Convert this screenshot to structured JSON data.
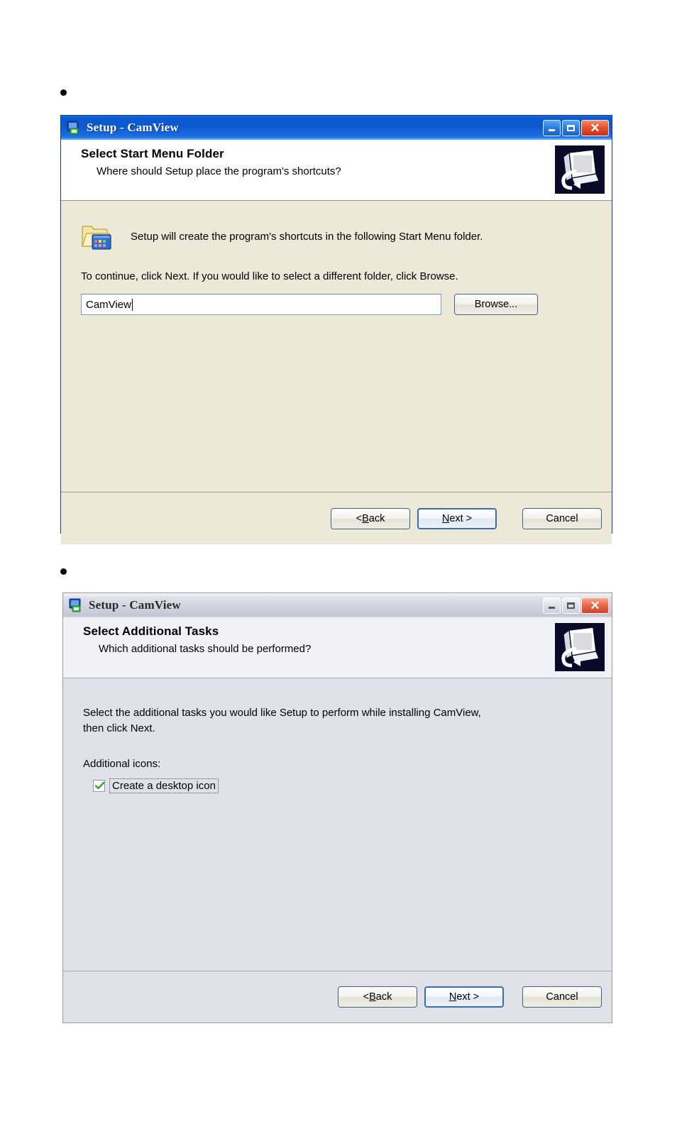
{
  "document": {
    "bullets": [
      "•",
      "•"
    ]
  },
  "dialog1": {
    "window_title": "Setup - CamView",
    "titlebar_icon": "setup-app-icon",
    "state": "active",
    "buttons": {
      "minimize": "minimize-icon",
      "maximize": "maximize-icon",
      "close": "close-icon",
      "close_glyph": "✕"
    },
    "header": {
      "title": "Select Start Menu Folder",
      "subtitle": "Where should Setup place the program's shortcuts?",
      "graphic": "computer-monitor-icon"
    },
    "body": {
      "folder_icon": "start-menu-folder-icon",
      "folder_text": "Setup will create the program's shortcuts in the following Start Menu folder.",
      "instruction": "To continue, click Next. If you would like to select a different folder, click Browse.",
      "input_value": "CamView",
      "input_placeholder": "",
      "browse_label_pre": "B",
      "browse_label_underline": "r",
      "browse_label_post": "owse..."
    },
    "footer": {
      "back_pre": "< ",
      "back_underline": "B",
      "back_post": "ack",
      "next_underline": "N",
      "next_post": "ext >",
      "cancel": "Cancel"
    }
  },
  "dialog2": {
    "window_title": "Setup - CamView",
    "titlebar_icon": "setup-app-icon",
    "state": "inactive",
    "buttons": {
      "minimize": "minimize-icon",
      "maximize": "maximize-icon",
      "close": "close-icon",
      "close_glyph": "✕"
    },
    "header": {
      "title": "Select Additional Tasks",
      "subtitle": "Which additional tasks should be performed?",
      "graphic": "computer-monitor-icon"
    },
    "body": {
      "instruction_line1": "Select the additional tasks you would like Setup to perform while installing CamView,",
      "instruction_line2": "then click Next.",
      "group_label": "Additional icons:",
      "checkbox_checked": true,
      "checkbox_label_pre": "Create a ",
      "checkbox_label_underline": "d",
      "checkbox_label_post": "esktop icon"
    },
    "footer": {
      "back_pre": "< ",
      "back_underline": "B",
      "back_post": "ack",
      "next_underline": "N",
      "next_post": "ext >",
      "cancel": "Cancel"
    }
  },
  "colors": {
    "titlebar_active": "#0a57cf",
    "titlebar_inactive": "#d4d4e0",
    "dialog_face": "#ece9d8",
    "dialog_face_inactive": "#e1e1e9",
    "close_button": "#c8301a",
    "check_green": "#3a9b3a",
    "graphic_background": "#0a0a28"
  }
}
